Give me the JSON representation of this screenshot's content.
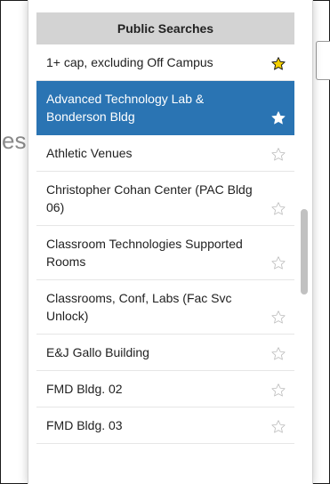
{
  "background": {
    "partial_text": "esu"
  },
  "dropdown": {
    "header": "Public Searches",
    "items": [
      {
        "label": "1+ cap, excluding Off Campus",
        "starred": true,
        "selected": false,
        "star_style": "yellow"
      },
      {
        "label": "Advanced Technology Lab & Bonderson Bldg",
        "starred": true,
        "selected": true,
        "star_style": "white"
      },
      {
        "label": "Athletic Venues",
        "starred": false,
        "selected": false,
        "star_style": "outline"
      },
      {
        "label": "Christopher Cohan Center (PAC Bldg 06)",
        "starred": false,
        "selected": false,
        "star_style": "outline"
      },
      {
        "label": "Classroom Technologies Supported Rooms",
        "starred": false,
        "selected": false,
        "star_style": "outline"
      },
      {
        "label": "Classrooms, Conf, Labs (Fac Svc Unlock)",
        "starred": false,
        "selected": false,
        "star_style": "outline"
      },
      {
        "label": "E&J Gallo Building",
        "starred": false,
        "selected": false,
        "star_style": "outline"
      },
      {
        "label": "FMD Bldg. 02",
        "starred": false,
        "selected": false,
        "star_style": "outline"
      },
      {
        "label": "FMD Bldg. 03",
        "starred": false,
        "selected": false,
        "star_style": "outline"
      }
    ]
  },
  "colors": {
    "selected_bg": "#2a74b3",
    "header_bg": "#d3d3d3",
    "star_yellow": "#f5d000",
    "star_outline": "#bdbdbd"
  },
  "icons": {
    "favorite": "star-icon"
  }
}
